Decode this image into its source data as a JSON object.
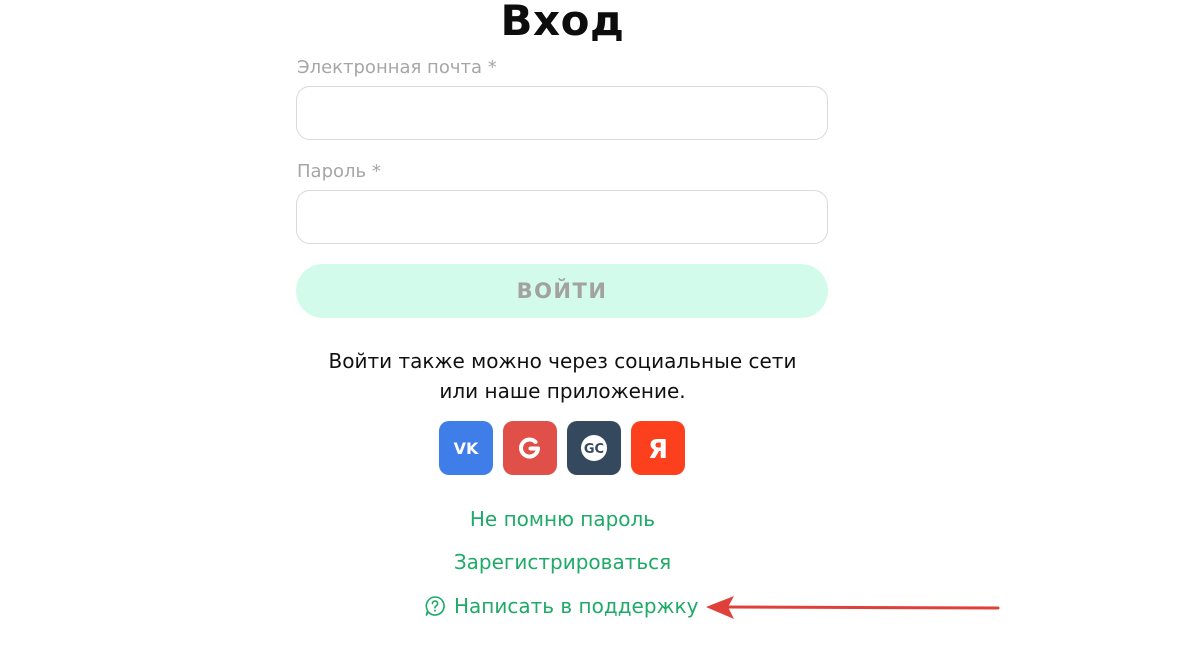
{
  "page": {
    "title": "Вход"
  },
  "form": {
    "email_label": "Электронная почта *",
    "email_value": "",
    "password_label": "Пароль *",
    "password_value": "",
    "submit_label": "ВОЙТИ"
  },
  "social": {
    "text_line1": "Войти также можно через социальные сети",
    "text_line2": "или наше приложение.",
    "buttons": [
      {
        "name": "vk",
        "icon": "vk-icon",
        "label": "VK",
        "color": "#3f7ee8"
      },
      {
        "name": "google",
        "icon": "google-icon",
        "label": "G",
        "color": "#e05048"
      },
      {
        "name": "getcourse",
        "icon": "getcourse-icon",
        "label": "GC",
        "color": "#34495e"
      },
      {
        "name": "yandex",
        "icon": "yandex-icon",
        "label": "Я",
        "color": "#fc3f1d"
      }
    ]
  },
  "links": {
    "forgot_password": "Не помню пароль",
    "register": "Зарегистрироваться",
    "support": "Написать в поддержку"
  },
  "colors": {
    "accent": "#1faa68",
    "button_bg": "#d3fbec",
    "annotation_arrow": "#e0403a"
  }
}
